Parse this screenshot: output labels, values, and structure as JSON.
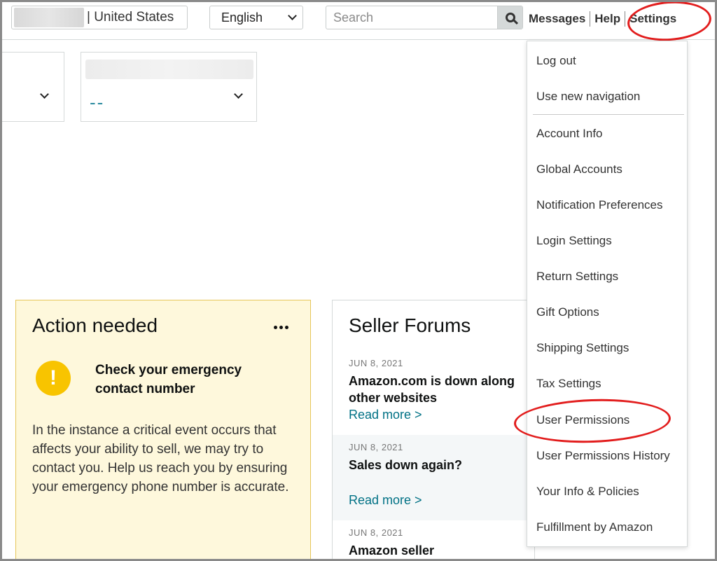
{
  "topbar": {
    "marketplace": "| United States",
    "language": "English",
    "search_placeholder": "Search",
    "links": {
      "messages": "Messages",
      "help": "Help",
      "settings": "Settings"
    }
  },
  "widgets": {
    "value": "--"
  },
  "action_card": {
    "title": "Action needed",
    "heading": "Check your emergency contact number",
    "body": "In the instance a critical event occurs that affects your ability to sell, we may try to contact you. Help us reach you by ensuring your emergency phone number is accurate."
  },
  "forums": {
    "title": "Seller Forums",
    "posts": [
      {
        "date": "JUN 8, 2021",
        "title_line1": "Amazon.com is down along",
        "title_line2": "other websites",
        "link": "Read more >"
      },
      {
        "date": "JUN 8, 2021",
        "title_line1": "Sales down again?",
        "link": "Read more >"
      },
      {
        "date": "JUN 8, 2021",
        "title_line1": "Amazon seller"
      }
    ]
  },
  "settings_menu": {
    "items": [
      "Log out",
      "Use new navigation",
      "Account Info",
      "Global Accounts",
      "Notification Preferences",
      "Login Settings",
      "Return Settings",
      "Gift Options",
      "Shipping Settings",
      "Tax Settings",
      "User Permissions",
      "User Permissions History",
      "Your Info & Policies",
      "Fulfillment by Amazon"
    ]
  },
  "annotation_color": "#e21d1d",
  "link_color": "#007185"
}
